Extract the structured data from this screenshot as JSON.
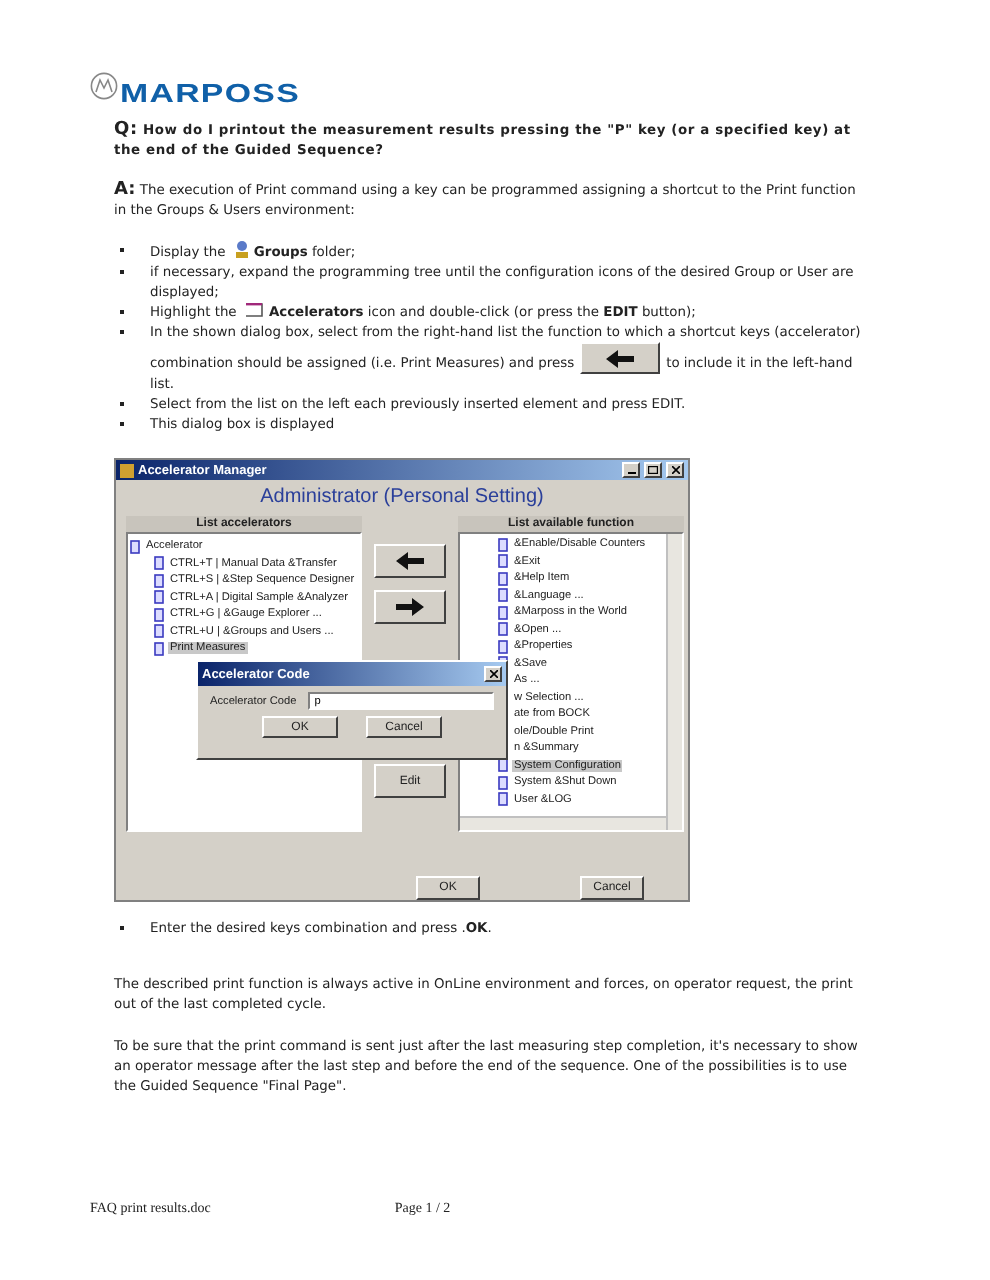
{
  "logo": {
    "text": "MARPOSS"
  },
  "question": {
    "prefix": "Q:",
    "text": "How do I printout the measurement results pressing the \"P\" key (or a specified key) at the end of the Guided Sequence?"
  },
  "answer": {
    "prefix": "A:",
    "text": "The execution of Print command using a key can be programmed assigning a shortcut to the Print function in the Groups & Users environment:"
  },
  "steps": [
    {
      "kind": "folder",
      "before": "Display the",
      "after": "**Groups** folder;"
    },
    {
      "kind": "plain",
      "before": "if necessary, expand the programming tree until the configuration icons of the desired Group or User are displayed;"
    },
    {
      "kind": "accel",
      "before": "Highlight the",
      "after": "**Accelerators** icon and double-click (or press the **EDIT** button);"
    },
    {
      "kind": "arrow",
      "before": "In the shown dialog box, select from the right-hand list the function to which a shortcut keys (accelerator) combination should be assigned (i.e. Print Measures) and press",
      "after": "to include it in the left-hand list."
    },
    {
      "kind": "plain",
      "before": "Select from the list on the left each previously inserted element and press EDIT."
    },
    {
      "kind": "plain",
      "before": "This dialog box is displayed"
    }
  ],
  "dialog": {
    "title": "Accelerator Manager",
    "header": "Administrator (Personal Setting)",
    "left_list": {
      "heading": "List accelerators",
      "items": [
        {
          "label": "Accelerator",
          "selected": false,
          "children": [
            {
              "label": "CTRL+T | Manual Data &Transfer",
              "selected": false
            },
            {
              "label": "CTRL+S | &Step Sequence Designer",
              "selected": false
            },
            {
              "label": "CTRL+A | Digital Sample &Analyzer",
              "selected": false
            },
            {
              "label": "CTRL+G | &Gauge Explorer ...",
              "selected": false
            },
            {
              "label": "CTRL+U | &Groups and Users ...",
              "selected": false
            },
            {
              "label": "Print Measures",
              "selected": true
            }
          ]
        }
      ]
    },
    "edit_button": "Edit",
    "right_list": {
      "heading": "List available function",
      "items": [
        {
          "label": "&Enable/Disable Counters",
          "selected": false
        },
        {
          "label": "&Exit",
          "selected": false
        },
        {
          "label": "&Help Item",
          "selected": false
        },
        {
          "label": "&Language ...",
          "selected": false
        },
        {
          "label": "&Marposs in the World",
          "selected": false
        },
        {
          "label": "&Open ...",
          "selected": false
        },
        {
          "label": "&Properties",
          "selected": false
        },
        {
          "label": "&Save",
          "selected": false
        },
        {
          "label": "As ...",
          "selected": false
        },
        {
          "label": "w Selection ...",
          "selected": false
        },
        {
          "label": "ate from BOCK",
          "selected": false
        },
        {
          "label": "ole/Double Print",
          "selected": false
        },
        {
          "label": "n &Summary",
          "selected": false
        },
        {
          "label": "System Configuration",
          "selected": true
        },
        {
          "label": "System &Shut Down",
          "selected": false
        },
        {
          "label": "User &LOG",
          "selected": false
        }
      ]
    },
    "ok": "OK",
    "cancel": "Cancel",
    "popup": {
      "title": "Accelerator Code",
      "label": "Accelerator Code",
      "value": "p",
      "ok": "OK",
      "cancel": "Cancel"
    }
  },
  "last_step": {
    "before": "Enter the desired keys combination and press .**OK**."
  },
  "paragraphs": [
    "The described print function is always active in OnLine environment and forces, on operator request, the print out of the last completed cycle.",
    "To be sure that the print command is sent just after the last measuring step completion, it's necessary to show an operator message after the last step and before the end of the sequence. One of the possibilities is to use the Guided Sequence \"Final Page\"."
  ],
  "footer": {
    "file": "FAQ print results.doc",
    "page": "Page 1 / 2"
  }
}
